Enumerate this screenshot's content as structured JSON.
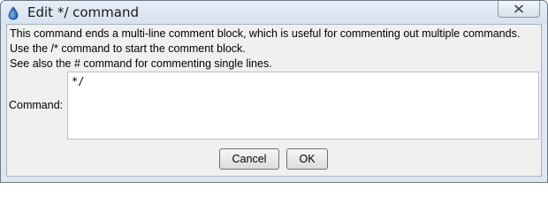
{
  "window": {
    "title": "Edit */ command",
    "icon": "water-drop-icon",
    "close_icon": "close-x-icon"
  },
  "description": {
    "lines": [
      "This command ends a multi-line comment block, which is useful for commenting out multiple commands.",
      "Use the /* command to start the comment block.",
      "See also the # command for commenting single lines."
    ]
  },
  "command": {
    "label": "Command:",
    "value": "*/"
  },
  "buttons": {
    "cancel_label": "Cancel",
    "ok_label": "OK"
  },
  "colors": {
    "frame": "#dde7f2",
    "panel": "#f0f0f0",
    "icon_blue": "#2d6fc4"
  }
}
